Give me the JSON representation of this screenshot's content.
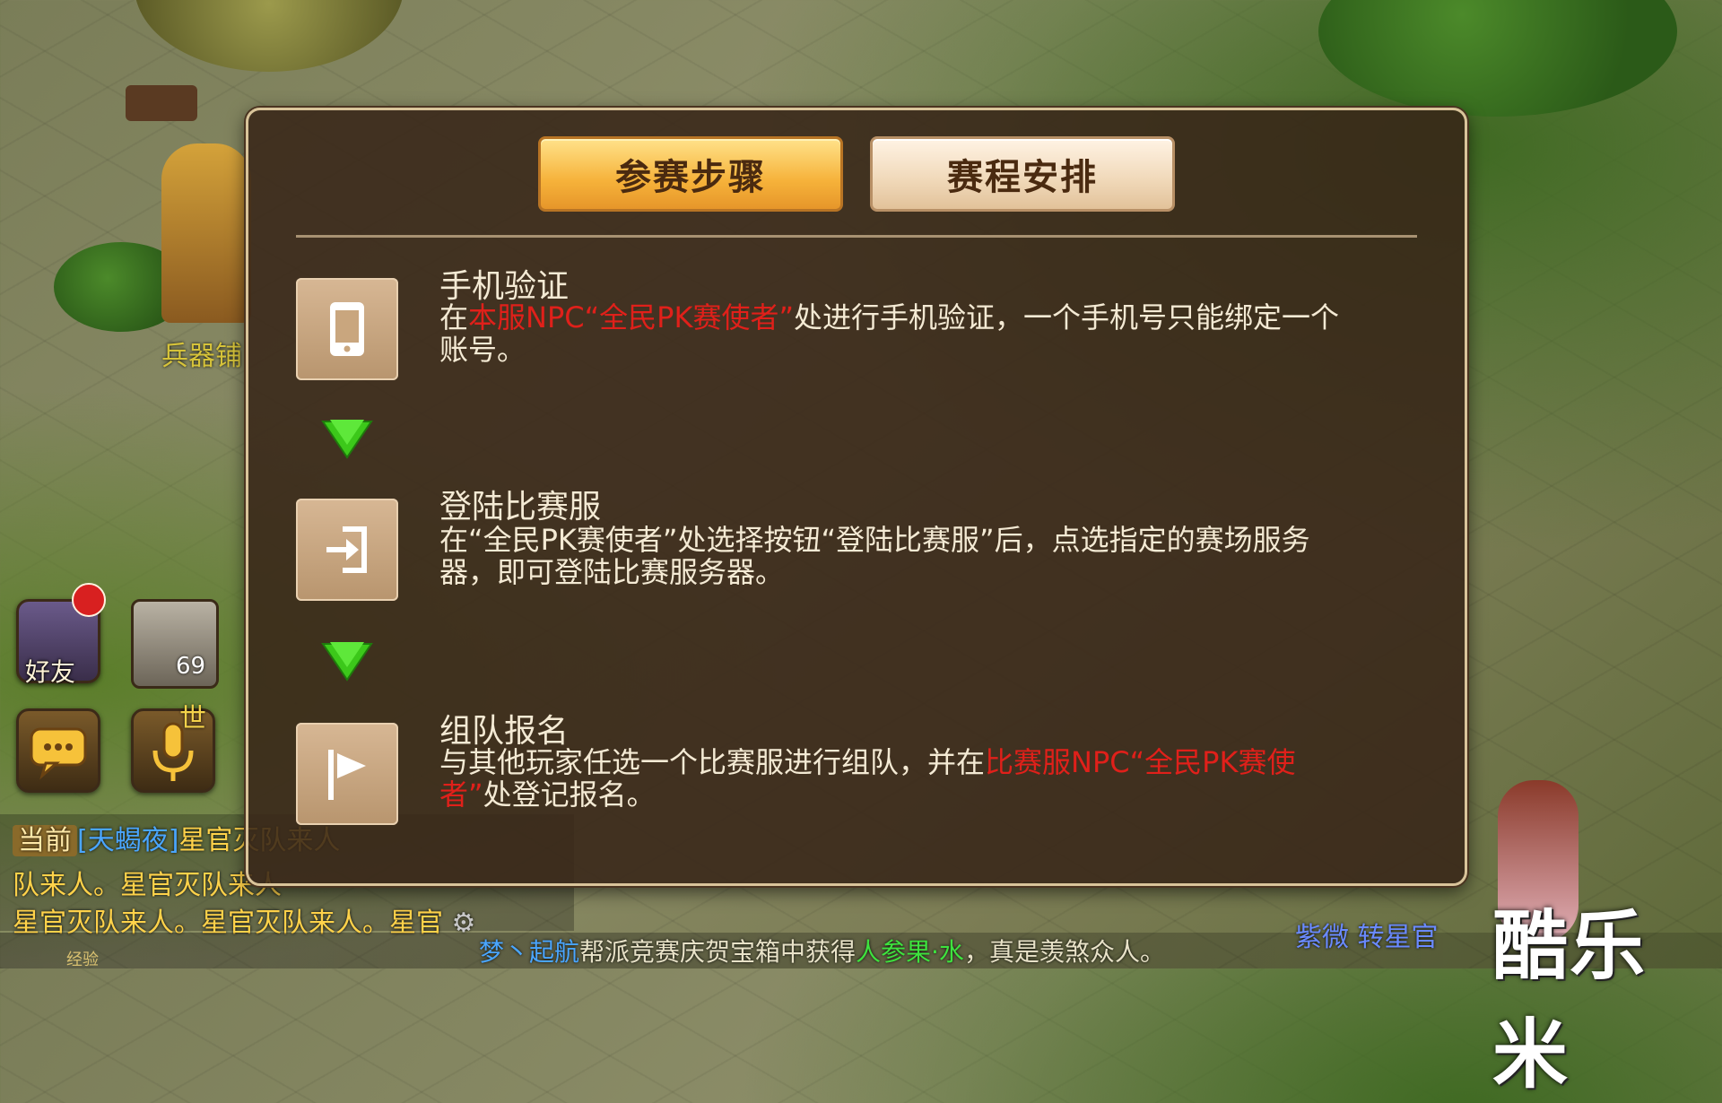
{
  "panel": {
    "tabs": [
      {
        "label": "参赛步骤",
        "active": true
      },
      {
        "label": "赛程安排",
        "active": false
      }
    ],
    "steps": [
      {
        "icon": "phone-icon",
        "title": "手机验证",
        "desc": {
          "p1": "在",
          "p2": "本服NPC“全民PK赛使者”",
          "p3": "处进行手机验证，一个手机号只能绑定一个账号。"
        }
      },
      {
        "icon": "login-icon",
        "title": "登陆比赛服",
        "desc": {
          "p1": "在“全民PK赛使者”处选择按钮“登陆比赛服”后，点选指定的赛场服务器，即可登陆比赛服务器。"
        }
      },
      {
        "icon": "flag-icon",
        "title": "组队报名",
        "desc": {
          "p1": "与其他玩家任选一个比赛服进行组队，并在",
          "p2": "比赛服NPC“全民PK赛使者”",
          "p3": "处登记报名。"
        }
      }
    ]
  },
  "hud": {
    "friend_label": "好友",
    "level": "69",
    "world_label": "世",
    "chat": {
      "line1_tag": "当前",
      "line1_name": "[天蝎夜]",
      "line1_text": "星官灭队来人",
      "line2_text": "队来人。星官灭队来人",
      "line3_text": "星官灭队来人。星官灭队来人。星官",
      "settings_icon": "⚙"
    },
    "exp_label": "经验"
  },
  "broadcast": {
    "name": "梦丶起航",
    "text1": "帮派竞赛庆贺宝箱中获得",
    "item": "人参果·水",
    "text2": "，真是羡煞众人。"
  },
  "scene": {
    "shop_label": "兵器铺",
    "right_names": "紫微  转星官"
  },
  "watermark": "酷乐米",
  "colors": {
    "highlight": "#e0201a",
    "tab_active": "#f6b23a",
    "tab_inactive": "#f0d8b8",
    "panel_bg": "#382618",
    "arrow_green": "#3cc81a"
  }
}
